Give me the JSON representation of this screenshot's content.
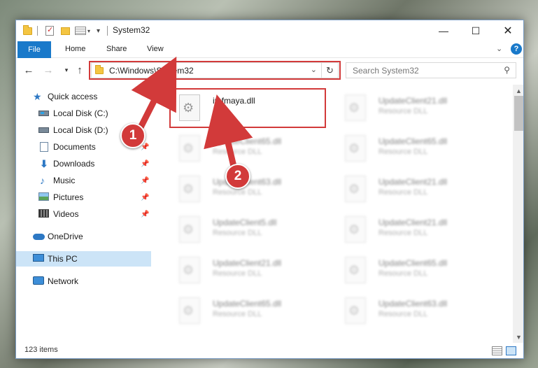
{
  "window": {
    "title": "System32"
  },
  "ribbon": {
    "file_tab": "File",
    "tabs": [
      "Home",
      "Share",
      "View"
    ],
    "help": "?"
  },
  "nav": {
    "address_path": "C:\\Windows\\System32",
    "search_placeholder": "Search System32"
  },
  "sidebar": {
    "items": [
      {
        "label": "Quick access",
        "icon": "star-icon"
      },
      {
        "label": "Local Disk (C:)",
        "icon": "disk-icon"
      },
      {
        "label": "Local Disk (D:)",
        "icon": "disk-icon"
      },
      {
        "label": "Documents",
        "icon": "documents-icon",
        "pinned": true
      },
      {
        "label": "Downloads",
        "icon": "download-icon",
        "pinned": true
      },
      {
        "label": "Music",
        "icon": "music-icon",
        "pinned": true
      },
      {
        "label": "Pictures",
        "icon": "pictures-icon",
        "pinned": true
      },
      {
        "label": "Videos",
        "icon": "videos-icon",
        "pinned": true
      },
      {
        "label": "OneDrive",
        "icon": "cloud-icon"
      },
      {
        "label": "This PC",
        "icon": "computer-icon",
        "selected": true
      },
      {
        "label": "Network",
        "icon": "network-icon"
      }
    ]
  },
  "files": [
    {
      "name": "imfmaya.dll",
      "type": ""
    },
    {
      "name": "UpdateClient21.dll",
      "type": "Resource DLL"
    },
    {
      "name": "UpdateClient65.dll",
      "type": "Resource DLL"
    },
    {
      "name": "UpdateClient65.dll",
      "type": "Resource DLL"
    },
    {
      "name": "UpdateClient63.dll",
      "type": "Resource DLL"
    },
    {
      "name": "UpdateClient21.dll",
      "type": "Resource DLL"
    },
    {
      "name": "UpdateClient5.dll",
      "type": "Resource DLL"
    },
    {
      "name": "UpdateClient21.dll",
      "type": "Resource DLL"
    },
    {
      "name": "UpdateClient21.dll",
      "type": "Resource DLL"
    },
    {
      "name": "UpdateClient65.dll",
      "type": "Resource DLL"
    },
    {
      "name": "UpdateClient65.dll",
      "type": "Resource DLL"
    },
    {
      "name": "UpdateClient63.dll",
      "type": "Resource DLL"
    }
  ],
  "status": {
    "item_count": "123 items"
  },
  "annotations": {
    "step1": "1",
    "step2": "2",
    "color": "#d23a3a"
  }
}
